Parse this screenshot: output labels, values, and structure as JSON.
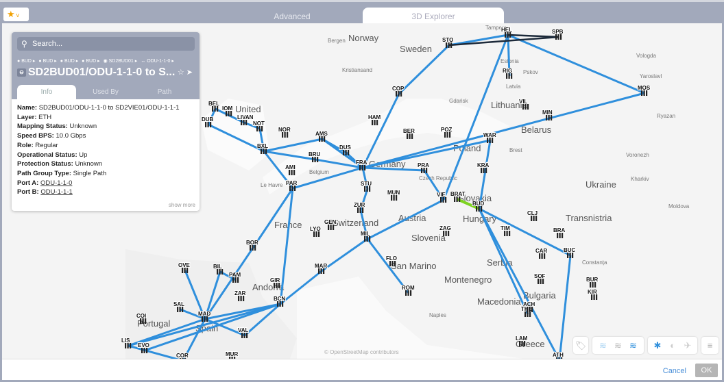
{
  "header": {
    "tabs": [
      {
        "label": "Advanced"
      },
      {
        "label": "3D Explorer"
      }
    ],
    "active_tab": "3D Explorer"
  },
  "panel": {
    "search_placeholder": "Search...",
    "breadcrumb": [
      "BUD",
      "BUD",
      "BUD",
      "BUD",
      "SD2BUD01",
      "ODU-1-1-0"
    ],
    "title": "SD2BUD01/ODU-1-1-0 to S...",
    "tabs": [
      "Info",
      "Used By",
      "Path"
    ],
    "fields": [
      {
        "k": "Name:",
        "v": "SD2BUD01/ODU-1-1-0 to SD2VIE01/ODU-1-1-1"
      },
      {
        "k": "Layer:",
        "v": "ETH"
      },
      {
        "k": "Mapping Status:",
        "v": "Unknown"
      },
      {
        "k": "Speed BPS:",
        "v": "10.0 Gbps"
      },
      {
        "k": "Role:",
        "v": "Regular"
      },
      {
        "k": "Operational Status:",
        "v": "Up"
      },
      {
        "k": "Protection Status:",
        "v": "Unknown"
      },
      {
        "k": "Path Group Type:",
        "v": "Single Path"
      },
      {
        "k": "Port A:",
        "v": "ODU-1-1-0",
        "link": true
      },
      {
        "k": "Port B:",
        "v": "ODU-1-1-1",
        "link": true
      }
    ],
    "show_more": "show more"
  },
  "map": {
    "attribution": "© OpenStreetMap contributors",
    "places": [
      "Norway",
      "Sweden",
      "Estonia",
      "Latvia",
      "Lithuania",
      "Belarus",
      "Poland",
      "Germany",
      "Czech Republic",
      "Slovakia",
      "Hungary",
      "Ukraine",
      "Transnistria",
      "Austria",
      "Slovenia",
      "Switzerland",
      "France",
      "Belgium",
      "San Marino",
      "Serbia",
      "Montenegro",
      "Bulgaria",
      "Macedonia",
      "Greece",
      "Portugal",
      "Spain",
      "Andorra",
      "United",
      "Tampere",
      "Bergen",
      "Kristiansand",
      "Gdańsk",
      "Brest",
      "Kharkiv",
      "Voronezh",
      "Ryazan",
      "Vologda",
      "Yaroslavl",
      "Pskov",
      "Naples",
      "Le Havre",
      "Moldova",
      "Constanța"
    ],
    "nodes": [
      "STO",
      "HEL",
      "SPB",
      "MOS",
      "RIG",
      "VIL",
      "MIN",
      "WAR",
      "KRA",
      "POZ",
      "BER",
      "HAM",
      "COP",
      "AMS",
      "BRU",
      "DUS",
      "FRA",
      "PRA",
      "STU",
      "MUN",
      "ZUR",
      "VIE",
      "BRAT",
      "BUD",
      "ZAG",
      "CLJ",
      "TIM",
      "BRA",
      "BUC",
      "CAR",
      "SOF",
      "BUR",
      "KIR",
      "THE",
      "ACH",
      "LAM",
      "ATH",
      "MIL",
      "GEN",
      "LYO",
      "FLO",
      "ROM",
      "MAR",
      "GIR",
      "BCN",
      "VAL",
      "MAD",
      "ZAR",
      "PAM",
      "BIL",
      "OVE",
      "SAL",
      "COI",
      "LIS",
      "EVO",
      "COR",
      "MUR",
      "BOR",
      "PAR",
      "AMI",
      "BXL",
      "NOR",
      "DUB",
      "BEL",
      "IOM",
      "LIVAN",
      "NOT"
    ],
    "link_color": "#2f8fdc",
    "highlight_color": "#7ed321",
    "dark_link_color": "#1d2a3a"
  },
  "controls": {
    "icons": [
      "tag-icon",
      "layers-light-icon",
      "layers-gray-icon",
      "layers-blue-icon",
      "gear-icon",
      "contrast-icon",
      "satellite-icon",
      "menu-icon"
    ]
  },
  "footer": {
    "cancel": "Cancel",
    "ok": "OK"
  }
}
